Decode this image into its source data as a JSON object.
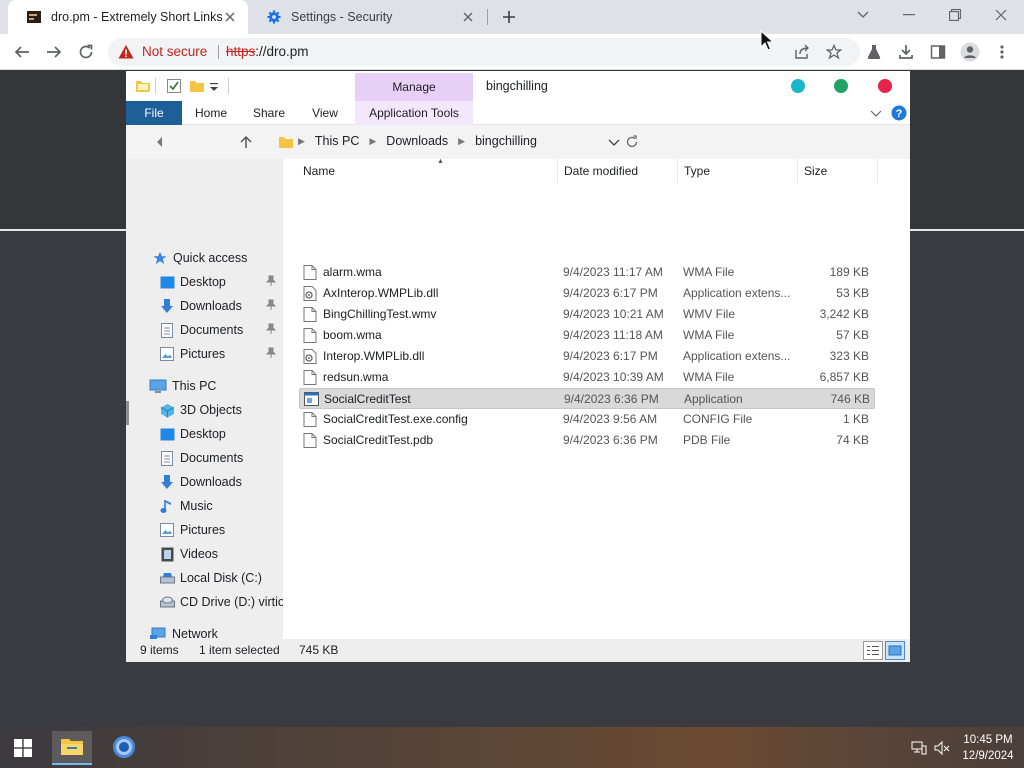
{
  "browser": {
    "tabs": [
      {
        "title": "dro.pm - Extremely Short Links",
        "active": true,
        "favicon": "dro-pm-favicon"
      },
      {
        "title": "Settings - Security",
        "active": false,
        "favicon": "gear-icon"
      }
    ],
    "omnibox": {
      "security_text": "Not secure",
      "url_scheme": "https",
      "url_rest": "://dro.pm"
    }
  },
  "explorer": {
    "title": "bingchilling",
    "manage_tab": "Manage",
    "ribbon_tabs": [
      "File",
      "Home",
      "Share",
      "View",
      "Application Tools"
    ],
    "breadcrumb": [
      "This PC",
      "Downloads",
      "bingchilling"
    ],
    "nav_pane": [
      {
        "label": "Quick access",
        "icon": "star-icon",
        "level": 0,
        "pinned": false
      },
      {
        "label": "Desktop",
        "icon": "desktop-icon",
        "level": 1,
        "pinned": true
      },
      {
        "label": "Downloads",
        "icon": "downloads-icon",
        "level": 1,
        "pinned": true
      },
      {
        "label": "Documents",
        "icon": "documents-icon",
        "level": 1,
        "pinned": true
      },
      {
        "label": "Pictures",
        "icon": "pictures-icon",
        "level": 1,
        "pinned": true
      },
      {
        "label": "This PC",
        "icon": "computer-icon",
        "level": 0,
        "pinned": false
      },
      {
        "label": "3D Objects",
        "icon": "cube-icon",
        "level": 1,
        "pinned": false
      },
      {
        "label": "Desktop",
        "icon": "desktop-icon",
        "level": 1,
        "pinned": false
      },
      {
        "label": "Documents",
        "icon": "documents-icon",
        "level": 1,
        "pinned": false
      },
      {
        "label": "Downloads",
        "icon": "downloads-icon",
        "level": 1,
        "pinned": false
      },
      {
        "label": "Music",
        "icon": "music-icon",
        "level": 1,
        "pinned": false
      },
      {
        "label": "Pictures",
        "icon": "pictures-icon",
        "level": 1,
        "pinned": false
      },
      {
        "label": "Videos",
        "icon": "videos-icon",
        "level": 1,
        "pinned": false
      },
      {
        "label": "Local Disk (C:)",
        "icon": "disk-icon",
        "level": 1,
        "pinned": false
      },
      {
        "label": "CD Drive (D:) virtio-",
        "icon": "cd-drive-icon",
        "level": 1,
        "pinned": false
      },
      {
        "label": "Network",
        "icon": "network-icon",
        "level": 0,
        "pinned": false
      }
    ],
    "columns": {
      "name": "Name",
      "date": "Date modified",
      "type": "Type",
      "size": "Size"
    },
    "files": [
      {
        "name": "alarm.wma",
        "date": "9/4/2023 11:17 AM",
        "type": "WMA File",
        "size": "189 KB",
        "icon": "audio-file-icon",
        "selected": false
      },
      {
        "name": "AxInterop.WMPLib.dll",
        "date": "9/4/2023 6:17 PM",
        "type": "Application extens...",
        "size": "53 KB",
        "icon": "dll-file-icon",
        "selected": false
      },
      {
        "name": "BingChillingTest.wmv",
        "date": "9/4/2023 10:21 AM",
        "type": "WMV File",
        "size": "3,242 KB",
        "icon": "video-file-icon",
        "selected": false
      },
      {
        "name": "boom.wma",
        "date": "9/4/2023 11:18 AM",
        "type": "WMA File",
        "size": "57 KB",
        "icon": "audio-file-icon",
        "selected": false
      },
      {
        "name": "Interop.WMPLib.dll",
        "date": "9/4/2023 6:17 PM",
        "type": "Application extens...",
        "size": "323 KB",
        "icon": "dll-file-icon",
        "selected": false
      },
      {
        "name": "redsun.wma",
        "date": "9/4/2023 10:39 AM",
        "type": "WMA File",
        "size": "6,857 KB",
        "icon": "audio-file-icon",
        "selected": false
      },
      {
        "name": "SocialCreditTest",
        "date": "9/4/2023 6:36 PM",
        "type": "Application",
        "size": "746 KB",
        "icon": "application-icon",
        "selected": true
      },
      {
        "name": "SocialCreditTest.exe.config",
        "date": "9/4/2023 9:56 AM",
        "type": "CONFIG File",
        "size": "1 KB",
        "icon": "config-file-icon",
        "selected": false
      },
      {
        "name": "SocialCreditTest.pdb",
        "date": "9/4/2023 6:36 PM",
        "type": "PDB File",
        "size": "74 KB",
        "icon": "pdb-file-icon",
        "selected": false
      }
    ],
    "status": {
      "items": "9 items",
      "selected": "1 item selected",
      "selected_size": "745 KB"
    }
  },
  "taskbar": {
    "time": "10:45 PM",
    "date": "12/9/2024"
  },
  "colors": {
    "file_tab": "#1e5f99",
    "manage_tab": "#e7d0f5",
    "dot_teal": "#1ab6c9",
    "dot_green": "#21a366",
    "dot_red": "#e8224b",
    "not_secure": "#c5221f"
  }
}
